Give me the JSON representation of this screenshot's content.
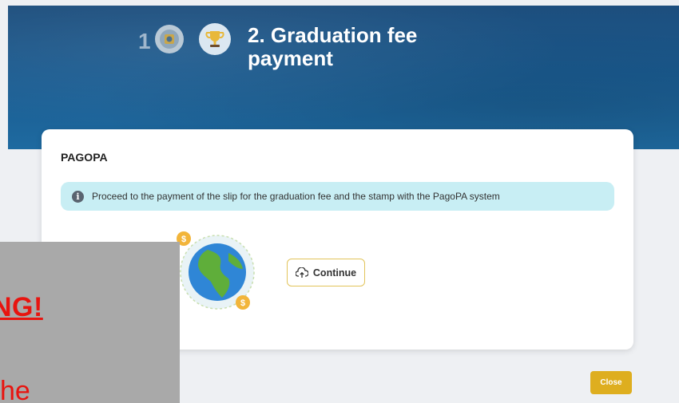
{
  "header": {
    "step_number": "1",
    "title": "2. Graduation fee payment"
  },
  "card": {
    "title": "PAGOPA",
    "info_text": "Proceed to the payment of the slip for the graduation fee and the stamp with the PagoPA system",
    "continue_label": "Continue"
  },
  "footer": {
    "close_label": "Close"
  },
  "overlay": {
    "warning_title": "ING!",
    "warning_body": "he"
  },
  "colors": {
    "banner": "#1a5a8f",
    "info_bar": "#c8eef4",
    "accent_gold": "#deae1f",
    "warning_red": "#e8140f",
    "overlay_grey": "#a9a9a9"
  },
  "icons": {
    "step1": "stamp-icon",
    "step2": "trophy-icon",
    "info": "info-icon",
    "globe": "globe-money-icon",
    "continue": "cloud-upload-icon"
  }
}
